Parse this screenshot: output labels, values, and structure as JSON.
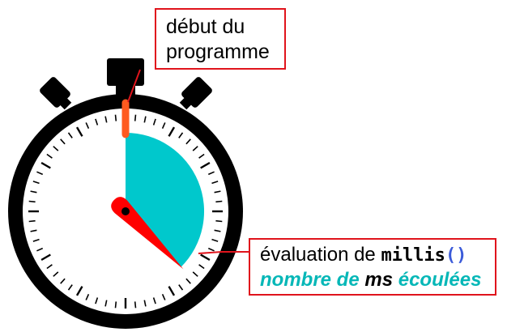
{
  "colors": {
    "case": "#000000",
    "dial": "#ffffff",
    "elapsed_sector": "#00c8cc",
    "start_marker": "#ff5a1f",
    "hand": "#ff0000",
    "callout_border": "#e0141c",
    "accent_text": "#05b7b7",
    "paren": "#3b5bd9"
  },
  "stopwatch": {
    "tick_count": 60,
    "elapsed_fraction": 0.375
  },
  "callouts": {
    "start": {
      "line1": "début du",
      "line2": "programme"
    },
    "evaluation": {
      "prefix": "évaluation de ",
      "function_name": "millis",
      "parens": "()",
      "result_part1": "nombre de",
      "result_part2": " ms ",
      "result_part3": "écoulées"
    }
  }
}
